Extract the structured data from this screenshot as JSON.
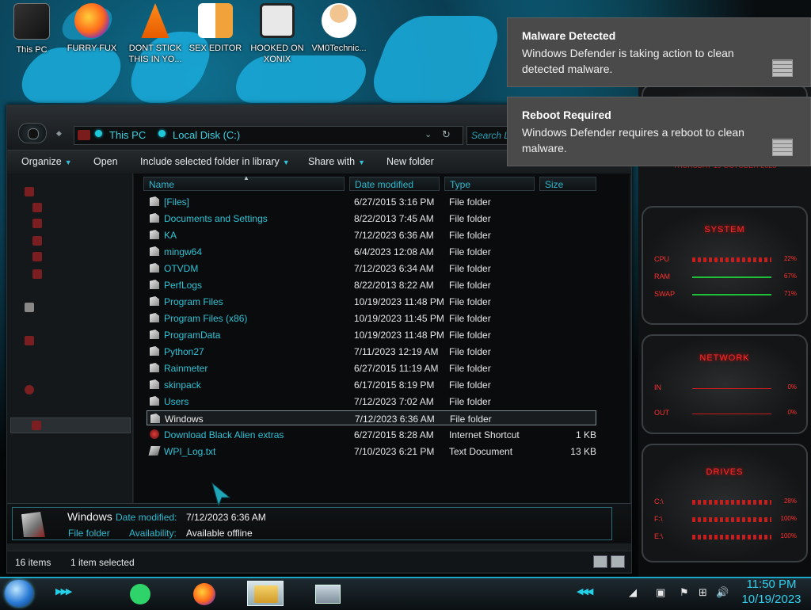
{
  "desktop": {
    "icons": [
      {
        "label": "This PC"
      },
      {
        "label": "FURRY FUX"
      },
      {
        "label": "DONT STICK THIS IN YO..."
      },
      {
        "label": "SEX EDITOR"
      },
      {
        "label": "HOOKED ON XONIX"
      },
      {
        "label": "VM0Technic..."
      }
    ]
  },
  "notifications": [
    {
      "title": "Malware Detected",
      "body": "Windows Defender is taking action to clean detected malware."
    },
    {
      "title": "Reboot Required",
      "body": "Windows Defender requires a reboot to clean malware."
    }
  ],
  "explorer": {
    "address": {
      "crumbs": [
        "This PC",
        "Local Disk (C:)"
      ]
    },
    "search": {
      "placeholder": "Search Lo"
    },
    "toolbar": {
      "organize": "Organize",
      "open": "Open",
      "include": "Include selected folder in library",
      "share": "Share with",
      "new_folder": "New folder"
    },
    "columns": {
      "name": "Name",
      "date": "Date modified",
      "type": "Type",
      "size": "Size"
    },
    "files": [
      {
        "name": "[Files]",
        "date": "6/27/2015 3:16 PM",
        "type": "File folder",
        "size": "",
        "icon": "folder-icon"
      },
      {
        "name": "Documents and Settings",
        "date": "8/22/2013 7:45 AM",
        "type": "File folder",
        "size": "",
        "icon": "folder-icon"
      },
      {
        "name": "KA",
        "date": "7/12/2023 6:36 AM",
        "type": "File folder",
        "size": "",
        "icon": "folder-icon"
      },
      {
        "name": "mingw64",
        "date": "6/4/2023 12:08 AM",
        "type": "File folder",
        "size": "",
        "icon": "folder-icon"
      },
      {
        "name": "OTVDM",
        "date": "7/12/2023 6:34 AM",
        "type": "File folder",
        "size": "",
        "icon": "folder-icon"
      },
      {
        "name": "PerfLogs",
        "date": "8/22/2013 8:22 AM",
        "type": "File folder",
        "size": "",
        "icon": "folder-icon"
      },
      {
        "name": "Program Files",
        "date": "10/19/2023 11:48 PM",
        "type": "File folder",
        "size": "",
        "icon": "folder-icon"
      },
      {
        "name": "Program Files (x86)",
        "date": "10/19/2023 11:45 PM",
        "type": "File folder",
        "size": "",
        "icon": "folder-icon"
      },
      {
        "name": "ProgramData",
        "date": "10/19/2023 11:48 PM",
        "type": "File folder",
        "size": "",
        "icon": "folder-icon"
      },
      {
        "name": "Python27",
        "date": "7/11/2023 12:19 AM",
        "type": "File folder",
        "size": "",
        "icon": "folder-icon"
      },
      {
        "name": "Rainmeter",
        "date": "6/27/2015 11:19 AM",
        "type": "File folder",
        "size": "",
        "icon": "folder-icon"
      },
      {
        "name": "skinpack",
        "date": "6/17/2015 8:19 PM",
        "type": "File folder",
        "size": "",
        "icon": "folder-icon"
      },
      {
        "name": "Users",
        "date": "7/12/2023 7:02 AM",
        "type": "File folder",
        "size": "",
        "icon": "folder-icon"
      },
      {
        "name": "Windows",
        "date": "7/12/2023 6:36 AM",
        "type": "File folder",
        "size": "",
        "icon": "folder-icon",
        "selected": true
      },
      {
        "name": "Download Black Alien extras",
        "date": "6/27/2015 8:28 AM",
        "type": "Internet Shortcut",
        "size": "1 KB",
        "icon": "internet-shortcut-icon"
      },
      {
        "name": "WPI_Log.txt",
        "date": "7/10/2023 6:21 PM",
        "type": "Text Document",
        "size": "13 KB",
        "icon": "text-document-icon"
      }
    ],
    "details": {
      "name": "Windows",
      "type": "File folder",
      "date_label": "Date modified:",
      "date_value": "7/12/2023 6:36 AM",
      "avail_label": "Availability:",
      "avail_value": "Available offline"
    },
    "status": {
      "items": "16 items",
      "selected": "1 item selected"
    }
  },
  "gadgets": {
    "system": {
      "title": "SYSTEM",
      "rows": [
        {
          "label": "CPU",
          "value": "22%"
        },
        {
          "label": "RAM",
          "value": "67%"
        },
        {
          "label": "SWAP",
          "value": "71%"
        }
      ]
    },
    "network": {
      "title": "NETWORK",
      "rows": [
        {
          "label": "IN",
          "value": "0%"
        },
        {
          "label": "OUT",
          "value": "0%"
        }
      ]
    },
    "drives": {
      "title": "DRIVES",
      "rows": [
        {
          "label": "C:\\",
          "value": "28%"
        },
        {
          "label": "F:\\",
          "value": "100%"
        },
        {
          "label": "E:\\",
          "value": "100%"
        }
      ]
    },
    "date_strip": "THURSDAY 19 OCTOBER 2023"
  },
  "taskbar": {
    "time": "11:50 PM",
    "date": "10/19/2023"
  },
  "colors": {
    "accent": "#2fc3d6",
    "alert_red": "#ff2a2a",
    "toast_bg": "#4a4a4a"
  }
}
